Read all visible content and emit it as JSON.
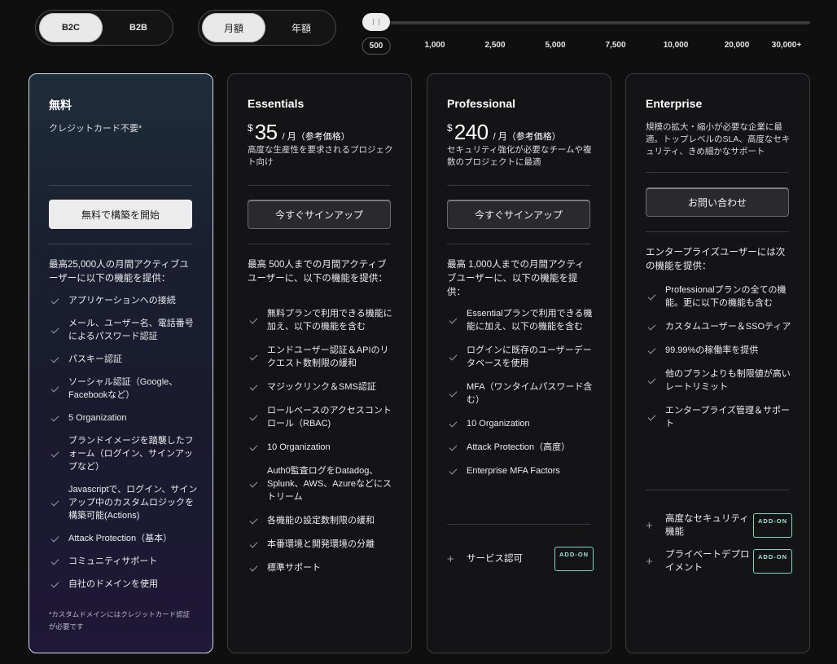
{
  "audience_toggle": {
    "options": [
      "B2C",
      "B2B"
    ],
    "selected": "B2C"
  },
  "period_toggle": {
    "options": [
      "月額",
      "年額"
    ],
    "selected": "月額"
  },
  "user_slider": {
    "ticks": [
      "500",
      "1,000",
      "2,500",
      "5,000",
      "7,500",
      "10,000",
      "20,000",
      "30,000+"
    ],
    "selected": "500"
  },
  "plans": [
    {
      "name": "無料",
      "subtitle": "クレジットカード不要*",
      "cta": "無料で構築を開始",
      "intro": "最高25,000人の月間アクティブユーザーに以下の機能を提供：",
      "features": [
        "アプリケーションへの接続",
        "メール、ユーザー名、電話番号によるパスワード認証",
        "パスキー認証",
        "ソーシャル認証（Google、Facebookなど）",
        "5 Organization",
        "ブランドイメージを踏襲したフォーム（ログイン、サインアップなど）",
        "Javascriptで、ログイン、サインアップ中のカスタムロジックを構築可能(Actions)",
        "Attack Protection（基本）",
        "コミュニティサポート",
        "自社のドメインを使用"
      ],
      "footnote": "*カスタムドメインにはクレジットカード認証が必要です"
    },
    {
      "name": "Essentials",
      "currency": "$",
      "price": "35",
      "per": "/ 月（参考価格）",
      "description": "高度な生産性を要求されるプロジェクト向け",
      "cta": "今すぐサインアップ",
      "intro": "最高 500人までの月間アクティブユーザーに、以下の機能を提供：",
      "features": [
        "無料プランで利用できる機能に加え、以下の機能を含む",
        "エンドユーザー認証＆APIのリクエスト数制限の緩和",
        "マジックリンク＆SMS認証",
        "ロールベースのアクセスコントロール（RBAC)",
        "10 Organization",
        "Auth0監査ログをDatadog、Splunk、AWS、Azureなどにストリーム",
        "各機能の設定数制限の緩和",
        "本番環境と開発環境の分離",
        "標準サポート"
      ]
    },
    {
      "name": "Professional",
      "currency": "$",
      "price": "240",
      "per": "/ 月（参考価格）",
      "description": "セキュリティ強化が必要なチームや複数のプロジェクトに最適",
      "cta": "今すぐサインアップ",
      "intro": "最高 1,000人までの月間アクティブユーザーに、以下の機能を提供：",
      "features": [
        "Essentialプランで利用できる機能に加え、以下の機能を含む",
        "ログインに既存のユーザーデータベースを使用",
        "MFA（ワンタイムパスワード含む）",
        "10 Organization",
        "Attack Protection（高度）",
        "Enterprise MFA Factors"
      ],
      "addons": [
        {
          "label": "サービス認可",
          "badge": "ADD-ON"
        }
      ]
    },
    {
      "name": "Enterprise",
      "description": "規模の拡大・縮小が必要な企業に最適。トップレベルのSLA、高度なセキュリティ、きめ細かなサポート",
      "cta": "お問い合わせ",
      "intro": "エンタープライズユーザーには次の機能を提供：",
      "features": [
        "Professionalプランの全ての機能。更に以下の機能も含む",
        "カスタムユーザー＆SSOティア",
        "99.99%の稼働率を提供",
        "他のプランよりも制限値が高いレートリミット",
        "エンタープライズ管理＆サポート"
      ],
      "addons": [
        {
          "label": "高度なセキュリティ機能",
          "badge": "ADD-ON"
        },
        {
          "label": "プライベートデプロイメント",
          "badge": "ADD-ON"
        }
      ]
    }
  ]
}
